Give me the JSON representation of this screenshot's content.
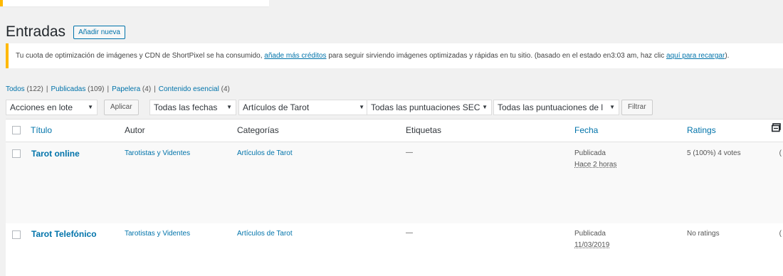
{
  "page": {
    "title": "Entradas",
    "add_new_label": "Añadir nueva"
  },
  "notice": {
    "text_before": "Tu cuota de optimización de imágenes y CDN de ShortPixel se ha consumido, ",
    "link1": "añade más créditos",
    "text_middle": " para seguir sirviendo imágenes optimizadas y rápidas en tu sitio. (basado en el estado en3:03 am, haz clic ",
    "link2": "aquí para recargar",
    "text_after": ")."
  },
  "views": [
    {
      "label": "Todos",
      "count": "(122)"
    },
    {
      "label": "Publicadas",
      "count": "(109)"
    },
    {
      "label": "Papelera",
      "count": "(4)"
    },
    {
      "label": "Contenido esencial",
      "count": "(4)"
    }
  ],
  "filters": {
    "bulk_actions": "Acciones en lote",
    "apply_label": "Aplicar",
    "dates": "Todas las fechas",
    "category": "Artículos de Tarot",
    "seo_score": "Todas las puntuaciones SEC",
    "readability_score": "Todas las puntuaciones de l",
    "filter_label": "Filtrar"
  },
  "columns": {
    "title": "Título",
    "author": "Autor",
    "categories": "Categorías",
    "tags": "Etiquetas",
    "date": "Fecha",
    "ratings": "Ratings"
  },
  "rows": [
    {
      "title": "Tarot online",
      "author": "Tarotistas y Videntes",
      "category": "Artículos de Tarot",
      "tags": "—",
      "status": "Publicada",
      "date": "Hace 2 horas",
      "ratings": "5 (100%) 4 votes",
      "edge": "("
    },
    {
      "title": "Tarot Telefónico",
      "author": "Tarotistas y Videntes",
      "category": "Artículos de Tarot",
      "tags": "—",
      "status": "Publicada",
      "date": "11/03/2019",
      "ratings": "No ratings",
      "edge": "("
    }
  ]
}
